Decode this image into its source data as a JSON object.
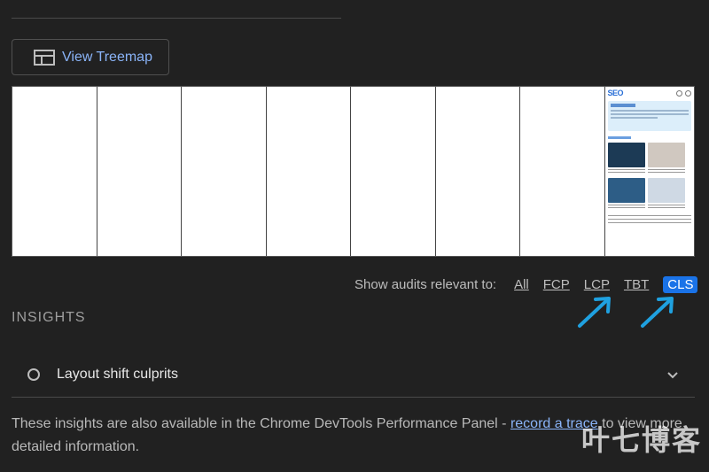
{
  "treemap_button": {
    "label": "View Treemap",
    "icon": "treemap-icon"
  },
  "thumbnail": {
    "logo": "SEO"
  },
  "audits_filter": {
    "prefix": "Show audits relevant to:",
    "options": [
      "All",
      "FCP",
      "LCP",
      "TBT",
      "CLS"
    ],
    "selected": "CLS",
    "accent": "#1a73e8"
  },
  "insights": {
    "heading": "INSIGHTS",
    "item_title": "Layout shift culprits"
  },
  "footer": {
    "before_link": "These insights are also available in the Chrome DevTools Performance Panel - ",
    "link_text": "record a trace",
    "after_link": " to view more detailed information."
  },
  "watermark": "叶七博客",
  "annotation_arrow_color": "#1fa1e0"
}
